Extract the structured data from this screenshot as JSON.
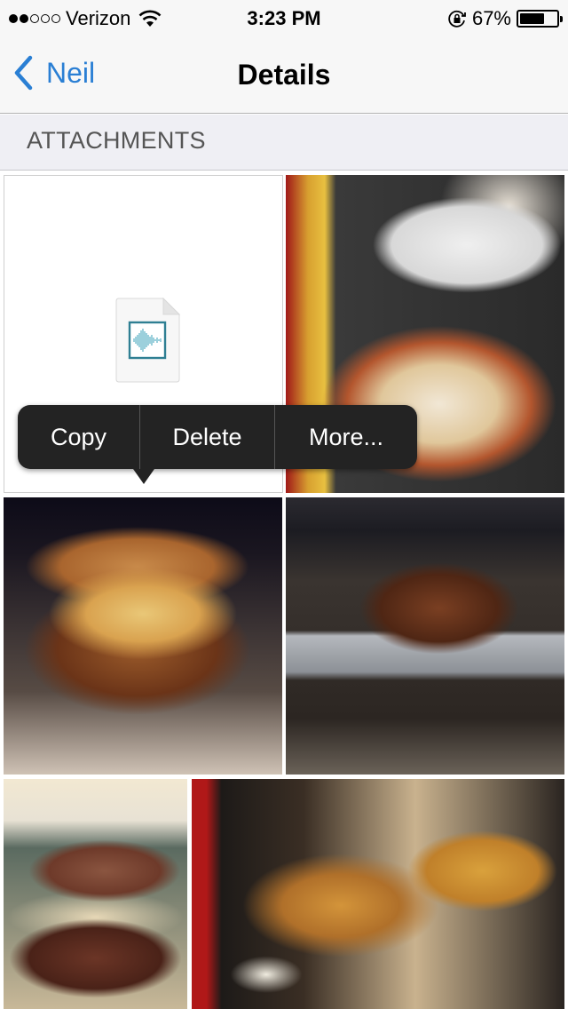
{
  "status_bar": {
    "signal_filled": 2,
    "signal_total": 5,
    "carrier": "Verizon",
    "time": "3:23 PM",
    "battery_percent": "67%",
    "battery_level": 0.67
  },
  "nav": {
    "back_label": "Neil",
    "title": "Details"
  },
  "section": {
    "title": "ATTACHMENTS"
  },
  "attachments": [
    {
      "type": "audio-file",
      "description": "audio file attachment"
    },
    {
      "type": "photo",
      "description": "breakfast plate with eggs, bacon and hash browns"
    },
    {
      "type": "photo",
      "description": "mac and cheese burger"
    },
    {
      "type": "photo",
      "description": "roasted turkey in oven pan"
    },
    {
      "type": "photo",
      "description": "pressed sandwich with shredded meat"
    },
    {
      "type": "photo",
      "description": "waffle sandwich with fries"
    }
  ],
  "context_menu": {
    "items": [
      "Copy",
      "Delete",
      "More..."
    ]
  },
  "colors": {
    "accent": "#2a7fd4",
    "menu_bg": "#232323",
    "section_bg": "#efeff4"
  }
}
